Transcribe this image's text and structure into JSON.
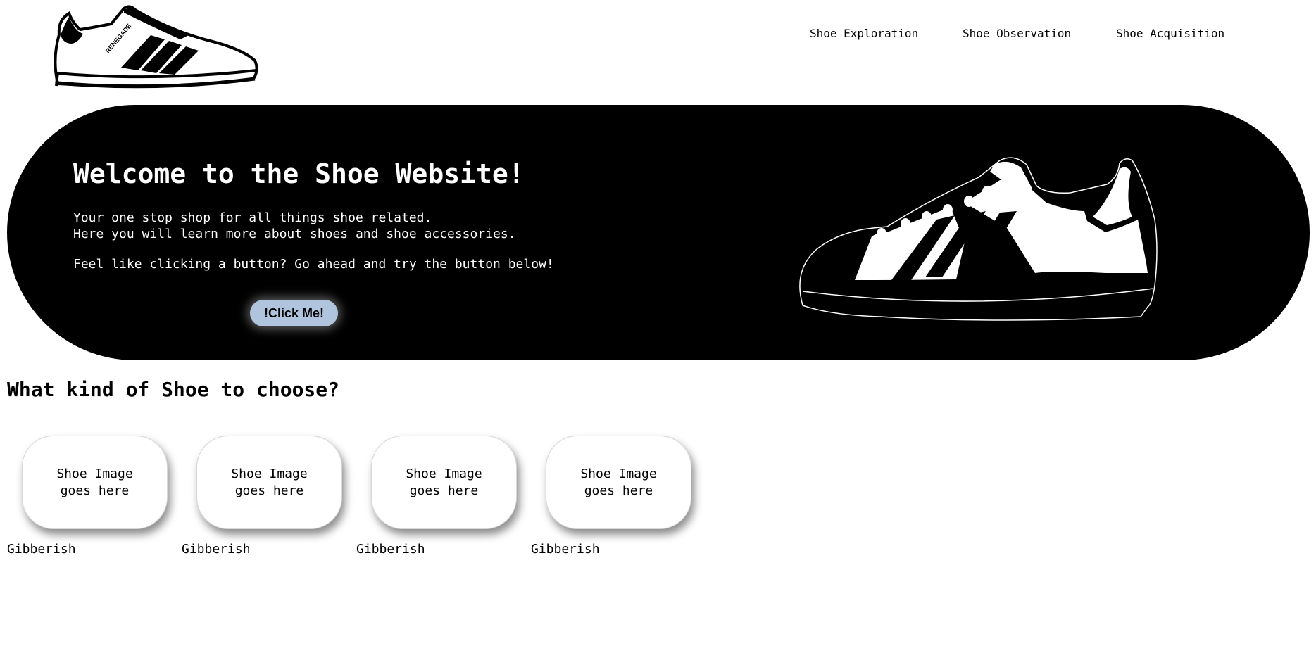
{
  "nav": {
    "items": [
      "Shoe Exploration",
      "Shoe Observation",
      "Shoe Acquisition"
    ]
  },
  "logo": {
    "brand_text": "RENEGADE"
  },
  "hero": {
    "title": "Welcome to the Shoe Website!",
    "line1": "Your one stop shop for all things shoe related.",
    "line2": "Here you will learn more about shoes and shoe accessories.",
    "line3": "Feel like clicking a button? Go ahead and try the button below!",
    "button_label": "!Click Me!",
    "button_color": "#b0c4de",
    "background": "#000000"
  },
  "section": {
    "title": "What kind of Shoe to choose?"
  },
  "cards": [
    {
      "placeholder": "Shoe Image goes here",
      "caption": "Gibberish"
    },
    {
      "placeholder": "Shoe Image goes here",
      "caption": "Gibberish"
    },
    {
      "placeholder": "Shoe Image goes here",
      "caption": "Gibberish"
    },
    {
      "placeholder": "Shoe Image goes here",
      "caption": "Gibberish"
    }
  ]
}
